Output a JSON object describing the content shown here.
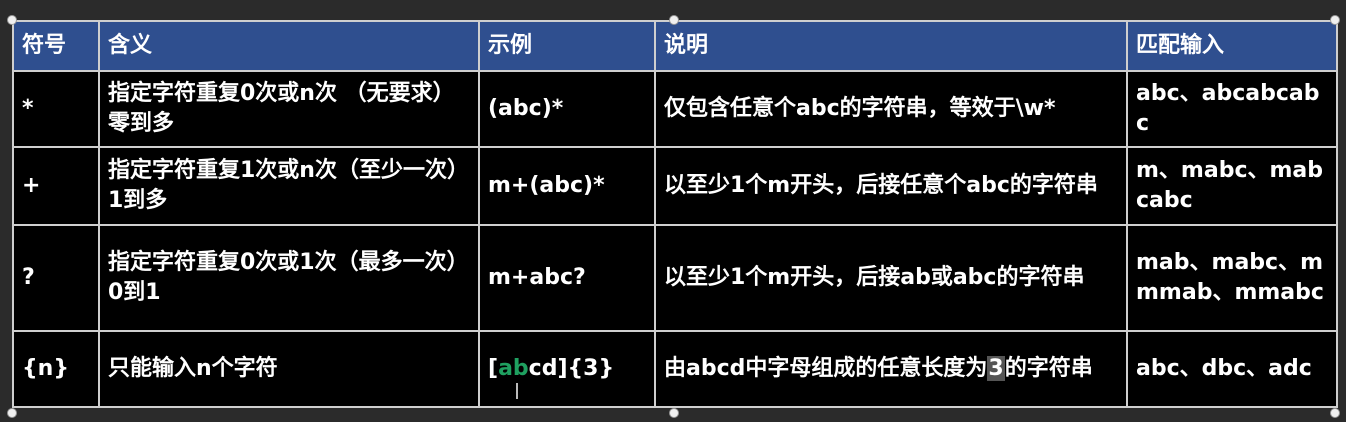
{
  "table": {
    "headers": [
      "符号",
      "含义",
      "示例",
      "说明",
      "匹配输入"
    ],
    "rows": [
      {
        "symbol": "*",
        "meaning": "指定字符重复0次或n次 （无要求）零到多",
        "example": "(abc)*",
        "description": "仅包含任意个abc的字符串，等效于\\w*",
        "match": "abc、abcabcabc"
      },
      {
        "symbol": "+",
        "meaning": "指定字符重复1次或n次（至少一次）1到多",
        "example": "m+(abc)*",
        "description": "以至少1个m开头，后接任意个abc的字符串",
        "match": "m、mabc、mabcabc"
      },
      {
        "symbol": "?",
        "meaning": "指定字符重复0次或1次（最多一次）0到1",
        "example": "m+abc?",
        "description": "以至少1个m开头，后接ab或abc的字符串",
        "match": "mab、mabc、mmmab、mmabc"
      },
      {
        "symbol": "{n}",
        "meaning": "只能输入n个字符",
        "example_parts": [
          "[",
          "ab",
          "cd]{3}"
        ],
        "description_parts": [
          "由abcd中字母组成的任意长度为",
          "3",
          "的字符串"
        ],
        "match": "abc、dbc、adc"
      }
    ]
  }
}
